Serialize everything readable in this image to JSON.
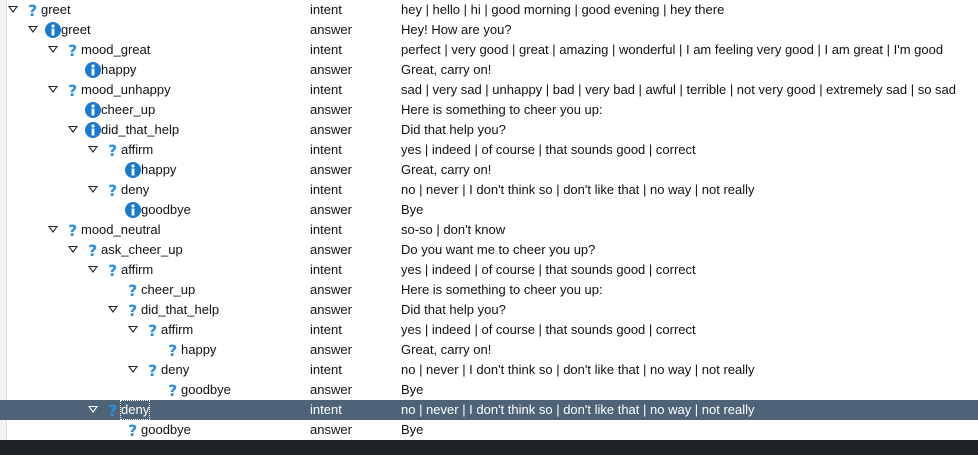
{
  "rows": [
    {
      "depth": 0,
      "icon": "question",
      "toggle": true,
      "name": "greet",
      "type": "intent",
      "text": "hey | hello | hi | good morning | good evening | hey there"
    },
    {
      "depth": 1,
      "icon": "info",
      "toggle": true,
      "name": "greet",
      "type": "answer",
      "text": "Hey! How are you?"
    },
    {
      "depth": 2,
      "icon": "question",
      "toggle": true,
      "name": "mood_great",
      "type": "intent",
      "text": "perfect | very good | great | amazing | wonderful | I am feeling very good | I am great | I'm good"
    },
    {
      "depth": 3,
      "icon": "info",
      "toggle": false,
      "name": "happy",
      "type": "answer",
      "text": "Great, carry on!"
    },
    {
      "depth": 2,
      "icon": "question",
      "toggle": true,
      "name": "mood_unhappy",
      "type": "intent",
      "text": "sad | very sad | unhappy | bad | very bad | awful | terrible | not very good | extremely sad | so sad"
    },
    {
      "depth": 3,
      "icon": "info",
      "toggle": false,
      "name": "cheer_up",
      "type": "answer",
      "text": "Here is something to cheer you up:"
    },
    {
      "depth": 3,
      "icon": "info",
      "toggle": true,
      "name": "did_that_help",
      "type": "answer",
      "text": "Did that help you?"
    },
    {
      "depth": 4,
      "icon": "question",
      "toggle": true,
      "name": "affirm",
      "type": "intent",
      "text": "yes | indeed | of course | that sounds good | correct"
    },
    {
      "depth": 5,
      "icon": "info",
      "toggle": false,
      "name": "happy",
      "type": "answer",
      "text": "Great, carry on!"
    },
    {
      "depth": 4,
      "icon": "question",
      "toggle": true,
      "name": "deny",
      "type": "intent",
      "text": "no | never | I don't think so | don't like that | no way | not really"
    },
    {
      "depth": 5,
      "icon": "info",
      "toggle": false,
      "name": "goodbye",
      "type": "answer",
      "text": "Bye"
    },
    {
      "depth": 2,
      "icon": "question",
      "toggle": true,
      "name": "mood_neutral",
      "type": "intent",
      "text": "so-so | don't know"
    },
    {
      "depth": 3,
      "icon": "question",
      "toggle": true,
      "name": "ask_cheer_up",
      "type": "answer",
      "text": "Do you want me to cheer you up?"
    },
    {
      "depth": 4,
      "icon": "question",
      "toggle": true,
      "name": "affirm",
      "type": "intent",
      "text": "yes | indeed | of course | that sounds good | correct"
    },
    {
      "depth": 5,
      "icon": "question",
      "toggle": false,
      "name": "cheer_up",
      "type": "answer",
      "text": "Here is something to cheer you up:"
    },
    {
      "depth": 5,
      "icon": "question",
      "toggle": true,
      "name": "did_that_help",
      "type": "answer",
      "text": "Did that help you?"
    },
    {
      "depth": 6,
      "icon": "question",
      "toggle": true,
      "name": "affirm",
      "type": "intent",
      "text": "yes | indeed | of course | that sounds good | correct"
    },
    {
      "depth": 7,
      "icon": "question",
      "toggle": false,
      "name": "happy",
      "type": "answer",
      "text": "Great, carry on!"
    },
    {
      "depth": 6,
      "icon": "question",
      "toggle": true,
      "name": "deny",
      "type": "intent",
      "text": "no | never | I don't think so | don't like that | no way | not really"
    },
    {
      "depth": 7,
      "icon": "question",
      "toggle": false,
      "name": "goodbye",
      "type": "answer",
      "text": "Bye"
    },
    {
      "depth": 4,
      "icon": "question",
      "toggle": true,
      "name": "deny",
      "type": "intent",
      "text": "no | never | I don't think so | don't like that | no way | not really",
      "selected": true
    },
    {
      "depth": 5,
      "icon": "question",
      "toggle": false,
      "name": "goodbye",
      "type": "answer",
      "text": "Bye"
    }
  ],
  "colors": {
    "question_icon": "#2a8ee0",
    "info_icon": "#1a79d0",
    "selection": "#4f6378"
  }
}
